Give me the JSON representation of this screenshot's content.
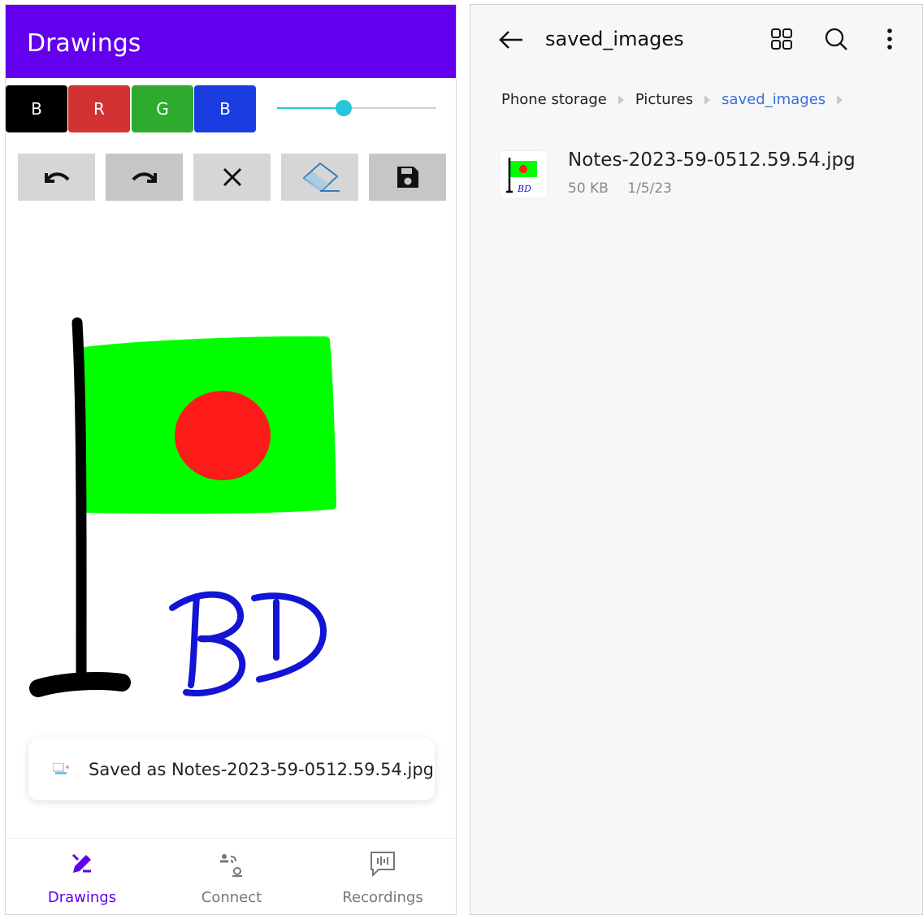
{
  "left": {
    "app_title": "Drawings",
    "color_buttons": [
      {
        "label": "B",
        "color": "#000000"
      },
      {
        "label": "R",
        "color": "#d23232"
      },
      {
        "label": "G",
        "color": "#2eaa2e"
      },
      {
        "label": "B",
        "color": "#1a3ce0"
      }
    ],
    "brush_slider": {
      "value_fraction": 0.42,
      "color": "#26c6da"
    },
    "tools": [
      {
        "name": "undo-icon"
      },
      {
        "name": "redo-icon"
      },
      {
        "name": "close-icon"
      },
      {
        "name": "eraser-icon"
      },
      {
        "name": "save-icon"
      }
    ],
    "drawing": {
      "flag_green": "#00ff00",
      "flag_red": "#ff1a1a",
      "pole_color": "#000000",
      "text": "BD",
      "text_color": "#1010d0"
    },
    "toast": {
      "text": "Saved as Notes-2023-59-0512.59.54.jpg"
    },
    "bottom_nav": [
      {
        "label": "Drawings",
        "icon": "pen-icon",
        "active": true
      },
      {
        "label": "Connect",
        "icon": "connect-icon",
        "active": false
      },
      {
        "label": "Recordings",
        "icon": "recordings-icon",
        "active": false
      }
    ],
    "accent": "#6200ee"
  },
  "right": {
    "title": "saved_images",
    "breadcrumbs": [
      "Phone storage",
      "Pictures",
      "saved_images"
    ],
    "files": [
      {
        "name": "Notes-2023-59-0512.59.54.jpg",
        "size": "50 KB",
        "date": "1/5/23"
      }
    ],
    "icons": [
      "back-arrow-icon",
      "grid-view-icon",
      "search-icon",
      "more-vert-icon"
    ]
  }
}
